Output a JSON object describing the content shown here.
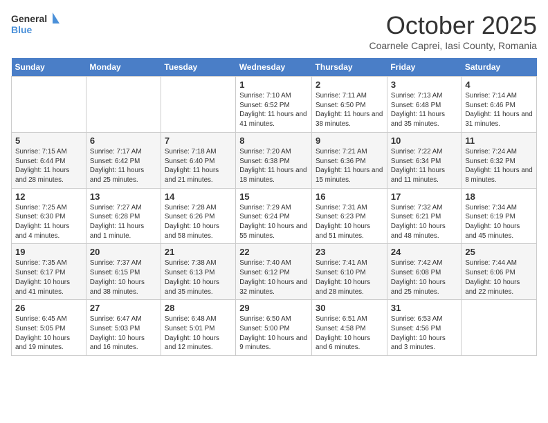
{
  "header": {
    "logo_line1": "General",
    "logo_line2": "Blue",
    "month_title": "October 2025",
    "subtitle": "Coarnele Caprei, Iasi County, Romania"
  },
  "days_of_week": [
    "Sunday",
    "Monday",
    "Tuesday",
    "Wednesday",
    "Thursday",
    "Friday",
    "Saturday"
  ],
  "weeks": [
    [
      {
        "day": "",
        "info": ""
      },
      {
        "day": "",
        "info": ""
      },
      {
        "day": "",
        "info": ""
      },
      {
        "day": "1",
        "info": "Sunrise: 7:10 AM\nSunset: 6:52 PM\nDaylight: 11 hours and 41 minutes."
      },
      {
        "day": "2",
        "info": "Sunrise: 7:11 AM\nSunset: 6:50 PM\nDaylight: 11 hours and 38 minutes."
      },
      {
        "day": "3",
        "info": "Sunrise: 7:13 AM\nSunset: 6:48 PM\nDaylight: 11 hours and 35 minutes."
      },
      {
        "day": "4",
        "info": "Sunrise: 7:14 AM\nSunset: 6:46 PM\nDaylight: 11 hours and 31 minutes."
      }
    ],
    [
      {
        "day": "5",
        "info": "Sunrise: 7:15 AM\nSunset: 6:44 PM\nDaylight: 11 hours and 28 minutes."
      },
      {
        "day": "6",
        "info": "Sunrise: 7:17 AM\nSunset: 6:42 PM\nDaylight: 11 hours and 25 minutes."
      },
      {
        "day": "7",
        "info": "Sunrise: 7:18 AM\nSunset: 6:40 PM\nDaylight: 11 hours and 21 minutes."
      },
      {
        "day": "8",
        "info": "Sunrise: 7:20 AM\nSunset: 6:38 PM\nDaylight: 11 hours and 18 minutes."
      },
      {
        "day": "9",
        "info": "Sunrise: 7:21 AM\nSunset: 6:36 PM\nDaylight: 11 hours and 15 minutes."
      },
      {
        "day": "10",
        "info": "Sunrise: 7:22 AM\nSunset: 6:34 PM\nDaylight: 11 hours and 11 minutes."
      },
      {
        "day": "11",
        "info": "Sunrise: 7:24 AM\nSunset: 6:32 PM\nDaylight: 11 hours and 8 minutes."
      }
    ],
    [
      {
        "day": "12",
        "info": "Sunrise: 7:25 AM\nSunset: 6:30 PM\nDaylight: 11 hours and 4 minutes."
      },
      {
        "day": "13",
        "info": "Sunrise: 7:27 AM\nSunset: 6:28 PM\nDaylight: 11 hours and 1 minute."
      },
      {
        "day": "14",
        "info": "Sunrise: 7:28 AM\nSunset: 6:26 PM\nDaylight: 10 hours and 58 minutes."
      },
      {
        "day": "15",
        "info": "Sunrise: 7:29 AM\nSunset: 6:24 PM\nDaylight: 10 hours and 55 minutes."
      },
      {
        "day": "16",
        "info": "Sunrise: 7:31 AM\nSunset: 6:23 PM\nDaylight: 10 hours and 51 minutes."
      },
      {
        "day": "17",
        "info": "Sunrise: 7:32 AM\nSunset: 6:21 PM\nDaylight: 10 hours and 48 minutes."
      },
      {
        "day": "18",
        "info": "Sunrise: 7:34 AM\nSunset: 6:19 PM\nDaylight: 10 hours and 45 minutes."
      }
    ],
    [
      {
        "day": "19",
        "info": "Sunrise: 7:35 AM\nSunset: 6:17 PM\nDaylight: 10 hours and 41 minutes."
      },
      {
        "day": "20",
        "info": "Sunrise: 7:37 AM\nSunset: 6:15 PM\nDaylight: 10 hours and 38 minutes."
      },
      {
        "day": "21",
        "info": "Sunrise: 7:38 AM\nSunset: 6:13 PM\nDaylight: 10 hours and 35 minutes."
      },
      {
        "day": "22",
        "info": "Sunrise: 7:40 AM\nSunset: 6:12 PM\nDaylight: 10 hours and 32 minutes."
      },
      {
        "day": "23",
        "info": "Sunrise: 7:41 AM\nSunset: 6:10 PM\nDaylight: 10 hours and 28 minutes."
      },
      {
        "day": "24",
        "info": "Sunrise: 7:42 AM\nSunset: 6:08 PM\nDaylight: 10 hours and 25 minutes."
      },
      {
        "day": "25",
        "info": "Sunrise: 7:44 AM\nSunset: 6:06 PM\nDaylight: 10 hours and 22 minutes."
      }
    ],
    [
      {
        "day": "26",
        "info": "Sunrise: 6:45 AM\nSunset: 5:05 PM\nDaylight: 10 hours and 19 minutes."
      },
      {
        "day": "27",
        "info": "Sunrise: 6:47 AM\nSunset: 5:03 PM\nDaylight: 10 hours and 16 minutes."
      },
      {
        "day": "28",
        "info": "Sunrise: 6:48 AM\nSunset: 5:01 PM\nDaylight: 10 hours and 12 minutes."
      },
      {
        "day": "29",
        "info": "Sunrise: 6:50 AM\nSunset: 5:00 PM\nDaylight: 10 hours and 9 minutes."
      },
      {
        "day": "30",
        "info": "Sunrise: 6:51 AM\nSunset: 4:58 PM\nDaylight: 10 hours and 6 minutes."
      },
      {
        "day": "31",
        "info": "Sunrise: 6:53 AM\nSunset: 4:56 PM\nDaylight: 10 hours and 3 minutes."
      },
      {
        "day": "",
        "info": ""
      }
    ]
  ]
}
